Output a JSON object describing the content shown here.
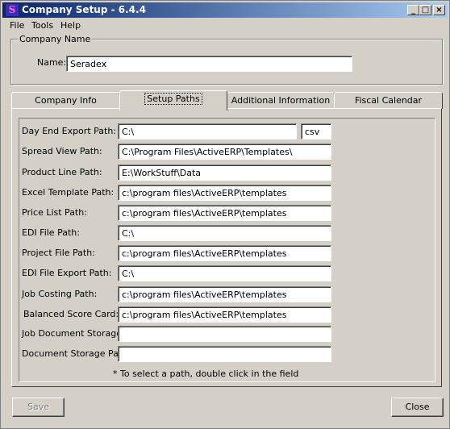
{
  "window": {
    "title": "Company Setup - 6.4.4"
  },
  "menu": [
    "File",
    "Tools",
    "Help"
  ],
  "company": {
    "legend": "Company Name",
    "name_label": "Name:",
    "name_value": "Seradex"
  },
  "tabs": [
    "Company Info",
    "Setup Paths",
    "Additional Information",
    "Fiscal Calendar"
  ],
  "active_tab": "Setup Paths",
  "paths": [
    {
      "label": "Day End Export Path:",
      "value": "C:\\"
    },
    {
      "label": "Spread View Path:",
      "value": "C:\\Program Files\\ActiveERP\\Templates\\"
    },
    {
      "label": "Product Line Path:",
      "value": "E:\\WorkStuff\\Data"
    },
    {
      "label": "Excel Template Path:",
      "value": "c:\\program files\\ActiveERP\\templates"
    },
    {
      "label": "Price List Path:",
      "value": "c:\\program files\\ActiveERP\\templates"
    },
    {
      "label": "EDI File Path:",
      "value": "C:\\"
    },
    {
      "label": "Project File Path:",
      "value": "c:\\program files\\ActiveERP\\templates"
    },
    {
      "label": "EDI File Export Path:",
      "value": "C:\\"
    },
    {
      "label": "Job Costing Path:",
      "value": "c:\\program files\\ActiveERP\\templates"
    },
    {
      "label": "Balanced Score Card:",
      "value": "c:\\program files\\ActiveERP\\templates"
    },
    {
      "label": "Job Document Storage:",
      "value": ""
    },
    {
      "label": "Document Storage Path:",
      "value": ""
    }
  ],
  "day_end_ext": "csv",
  "hint": "* To select a path, double click in the field",
  "buttons": {
    "save": "Save",
    "close": "Close"
  }
}
